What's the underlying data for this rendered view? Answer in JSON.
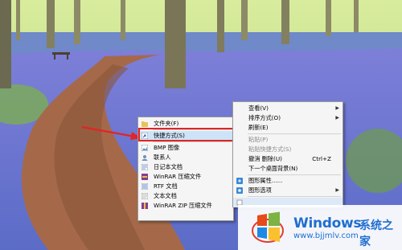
{
  "new_submenu": {
    "items": [
      {
        "label": "文件夹(F)",
        "icon": "folder-icon"
      },
      {
        "label": "快捷方式(S)",
        "icon": "shortcut-icon",
        "highlighted": true
      },
      {
        "label": "BMP 图像",
        "icon": "bmp-image-icon"
      },
      {
        "label": "联系人",
        "icon": "contact-icon"
      },
      {
        "label": "日记本文档",
        "icon": "journal-icon"
      },
      {
        "label": "WinRAR 压缩文件",
        "icon": "winrar-icon"
      },
      {
        "label": "RTF 文档",
        "icon": "rtf-document-icon"
      },
      {
        "label": "文本文档",
        "icon": "text-document-icon"
      },
      {
        "label": "WinRAR ZIP 压缩文件",
        "icon": "winrar-zip-icon"
      }
    ]
  },
  "context_menu": {
    "view": "查看(V)",
    "sort": "排序方式(O)",
    "refresh": "刷新(E)",
    "paste": "粘贴(P)",
    "paste_shortcut": "粘贴快捷方式(S)",
    "undo_delete": "撤消 删除(U)",
    "undo_shortcut": "Ctrl+Z",
    "next_background": "下一个桌面背景(N)",
    "graphics_properties": "图形属性......",
    "graphics_options": "图形选项"
  },
  "watermark": {
    "brand": "Windows",
    "brand_cn": "系统之家",
    "url": "www.bjjmlv.com"
  },
  "colors": {
    "highlight_border": "#e32424",
    "arrow": "#e32424",
    "brand_blue": "#1f6fcf"
  }
}
